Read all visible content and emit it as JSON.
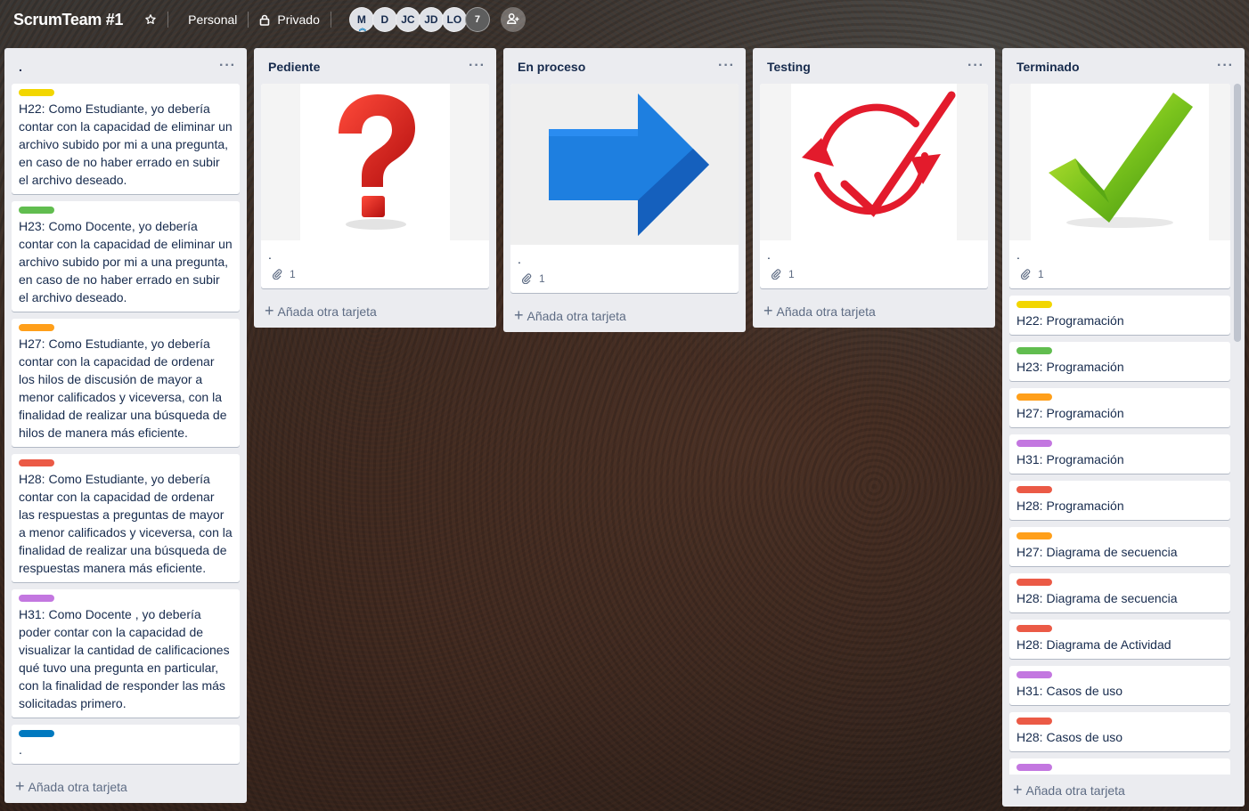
{
  "colors": {
    "yellow": "#f2d600",
    "green": "#61bd4f",
    "orange": "#ff9f1a",
    "red": "#eb5a46",
    "purple": "#c377e0",
    "blue": "#0079bf"
  },
  "header": {
    "title": "ScrumTeam #1",
    "workspace": "Personal",
    "visibility": "Privado",
    "members": [
      "M",
      "D",
      "JC",
      "JD",
      "LO"
    ],
    "member_overflow": "7"
  },
  "lists": {
    "backlog": {
      "title": ".",
      "menu": "···",
      "cards": [
        {
          "label_color": "yellow",
          "text": "H22: Como Estudiante, yo debería contar con la capacidad de eliminar un archivo subido por mi a una pregunta, en caso de no haber errado en subir el archivo deseado."
        },
        {
          "label_color": "green",
          "text": "H23: Como Docente, yo debería contar con la capacidad de eliminar un archivo subido por mi a una pregunta, en caso de no haber errado en subir el archivo deseado."
        },
        {
          "label_color": "orange",
          "text": "H27: Como Estudiante, yo debería contar con la capacidad de ordenar los hilos de discusión de mayor a menor calificados y viceversa, con la finalidad de realizar una búsqueda de hilos de manera más eficiente."
        },
        {
          "label_color": "red",
          "text": "H28: Como Estudiante, yo debería contar con la capacidad de ordenar las respuestas a preguntas de mayor a menor calificados y viceversa, con la finalidad de realizar una búsqueda de respuestas manera más eficiente."
        },
        {
          "label_color": "purple",
          "text": "H31: Como Docente , yo debería poder contar con la capacidad de visualizar la cantidad de calificaciones qué tuvo una pregunta en particular, con la finalidad de responder las más solicitadas primero."
        },
        {
          "label_color": "blue",
          "text": "."
        }
      ],
      "add_label": "Añada otra tarjeta"
    },
    "pending": {
      "title": "Pediente",
      "menu": "···",
      "cover_card": {
        "title": ".",
        "attachments": "1",
        "icon": "question-mark"
      },
      "add_label": "Añada otra tarjeta"
    },
    "in_progress": {
      "title": "En proceso",
      "menu": "···",
      "cover_card": {
        "title": ".",
        "attachments": "1",
        "icon": "right-arrow"
      },
      "add_label": "Añada otra tarjeta"
    },
    "testing": {
      "title": "Testing",
      "menu": "···",
      "cover_card": {
        "title": ".",
        "attachments": "1",
        "icon": "refresh-check"
      },
      "add_label": "Añada otra tarjeta"
    },
    "done": {
      "title": "Terminado",
      "menu": "···",
      "cover_card": {
        "title": ".",
        "attachments": "1",
        "icon": "green-checkmark"
      },
      "cards": [
        {
          "label_color": "yellow",
          "text": "H22: Programación"
        },
        {
          "label_color": "green",
          "text": "H23: Programación"
        },
        {
          "label_color": "orange",
          "text": "H27: Programación"
        },
        {
          "label_color": "purple",
          "text": "H31: Programación"
        },
        {
          "label_color": "red",
          "text": "H28: Programación"
        },
        {
          "label_color": "orange",
          "text": "H27: Diagrama de secuencia"
        },
        {
          "label_color": "red",
          "text": "H28: Diagrama de secuencia"
        },
        {
          "label_color": "red",
          "text": "H28: Diagrama de Actividad"
        },
        {
          "label_color": "purple",
          "text": "H31: Casos de uso"
        },
        {
          "label_color": "red",
          "text": "H28: Casos de uso"
        },
        {
          "label_color": "purple",
          "text": ""
        }
      ],
      "add_label": "Añada otra tarjeta"
    }
  }
}
